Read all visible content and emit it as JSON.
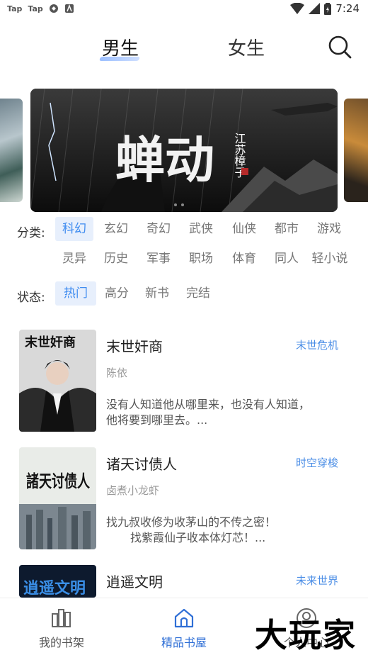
{
  "status_bar": {
    "left_items": [
      "Tap",
      "Tap"
    ],
    "time": "7:24"
  },
  "header": {
    "tabs": [
      {
        "label": "男生",
        "active": true
      },
      {
        "label": "女生",
        "active": false
      }
    ],
    "search_icon": "search-icon"
  },
  "banner": {
    "main_title": "蝉动",
    "main_author": "江苏樟子"
  },
  "categories": {
    "label": "分类:",
    "row1": [
      "科幻",
      "玄幻",
      "奇幻",
      "武侠",
      "仙侠",
      "都市",
      "游戏"
    ],
    "row2": [
      "灵异",
      "历史",
      "军事",
      "职场",
      "体育",
      "同人",
      "轻小说"
    ],
    "active": "科幻"
  },
  "status_filter": {
    "label": "状态:",
    "options": [
      "热门",
      "高分",
      "新书",
      "完结"
    ],
    "active": "热门"
  },
  "books": [
    {
      "title": "末世奸商",
      "tag": "末世危机",
      "author": "陈依",
      "desc_line1": "没有人知道他从哪里来，也没有人知道，",
      "desc_line2": "他将要到哪里去。...",
      "cover_text": "末世奸商"
    },
    {
      "title": "诸天讨债人",
      "tag": "时空穿梭",
      "author": "卤煮小龙虾",
      "desc_line1": "找九叔收修为收茅山的不传之密！",
      "desc_line2": "找紫霞仙子收本体灯芯！...",
      "cover_text": "諸天讨债人"
    },
    {
      "title": "逍遥文明",
      "tag": "未来世界",
      "author": "",
      "desc_line1": "",
      "desc_line2": "",
      "cover_text": "逍遥文明"
    }
  ],
  "bottom_nav": [
    {
      "label": "我的书架",
      "icon": "bookshelf-icon",
      "active": false
    },
    {
      "label": "精品书屋",
      "icon": "store-icon",
      "active": true
    },
    {
      "label": "个人中心",
      "icon": "person-icon",
      "active": false
    }
  ],
  "watermark": "大玩家",
  "colors": {
    "accent": "#3f8cf0",
    "chip_active_bg": "#e7effc",
    "nav_active": "#2f6fd6"
  }
}
